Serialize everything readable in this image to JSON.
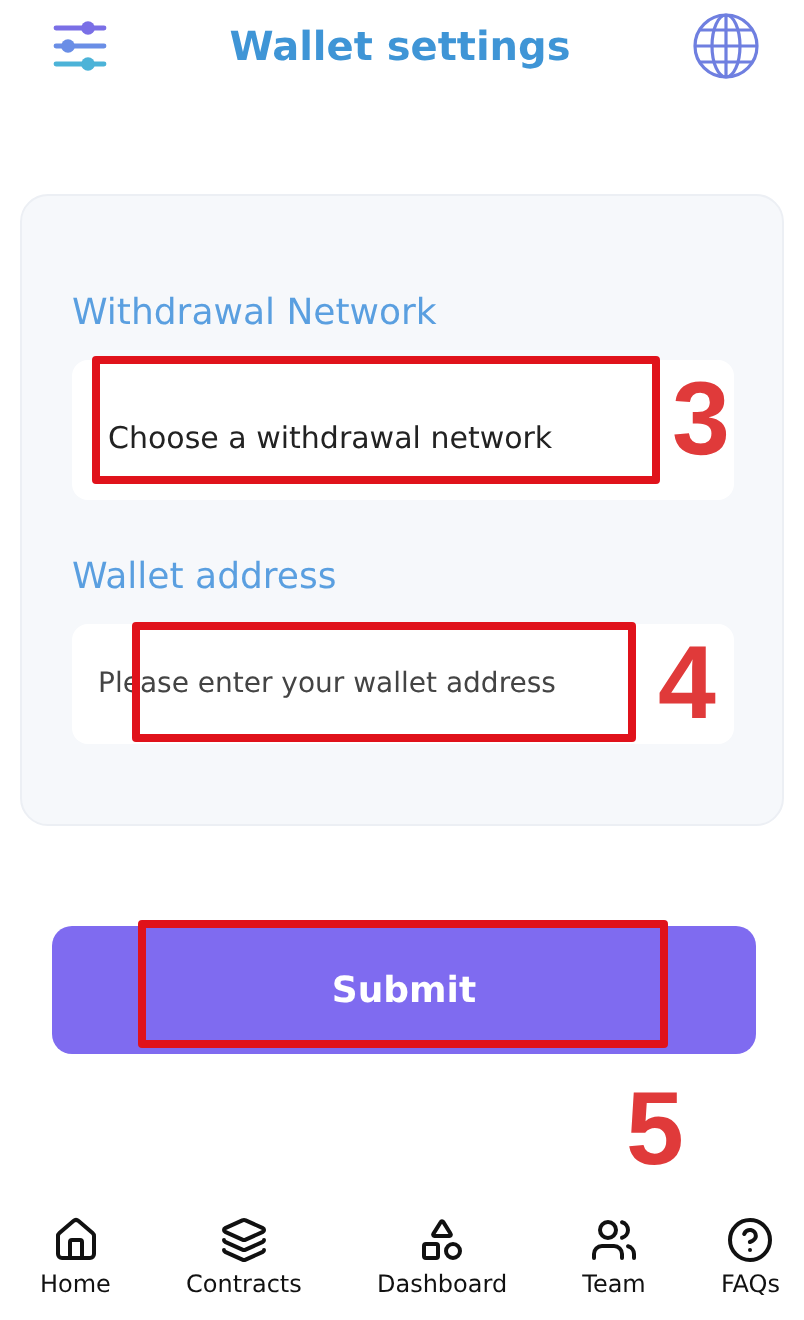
{
  "header": {
    "title": "Wallet settings"
  },
  "form": {
    "fields": [
      {
        "kind": "select",
        "label": "Withdrawal Network",
        "value": "Choose a withdrawal network",
        "annotation": "3"
      },
      {
        "kind": "input",
        "label": "Wallet address",
        "placeholder": "Please enter your wallet address",
        "annotation": "4"
      }
    ]
  },
  "submit": {
    "label": "Submit",
    "annotation": "5"
  },
  "nav": [
    {
      "kind": "home",
      "label": "Home"
    },
    {
      "kind": "layers",
      "label": "Contracts"
    },
    {
      "kind": "grid",
      "label": "Dashboard"
    },
    {
      "kind": "people",
      "label": "Team"
    },
    {
      "kind": "help",
      "label": "FAQs"
    }
  ]
}
